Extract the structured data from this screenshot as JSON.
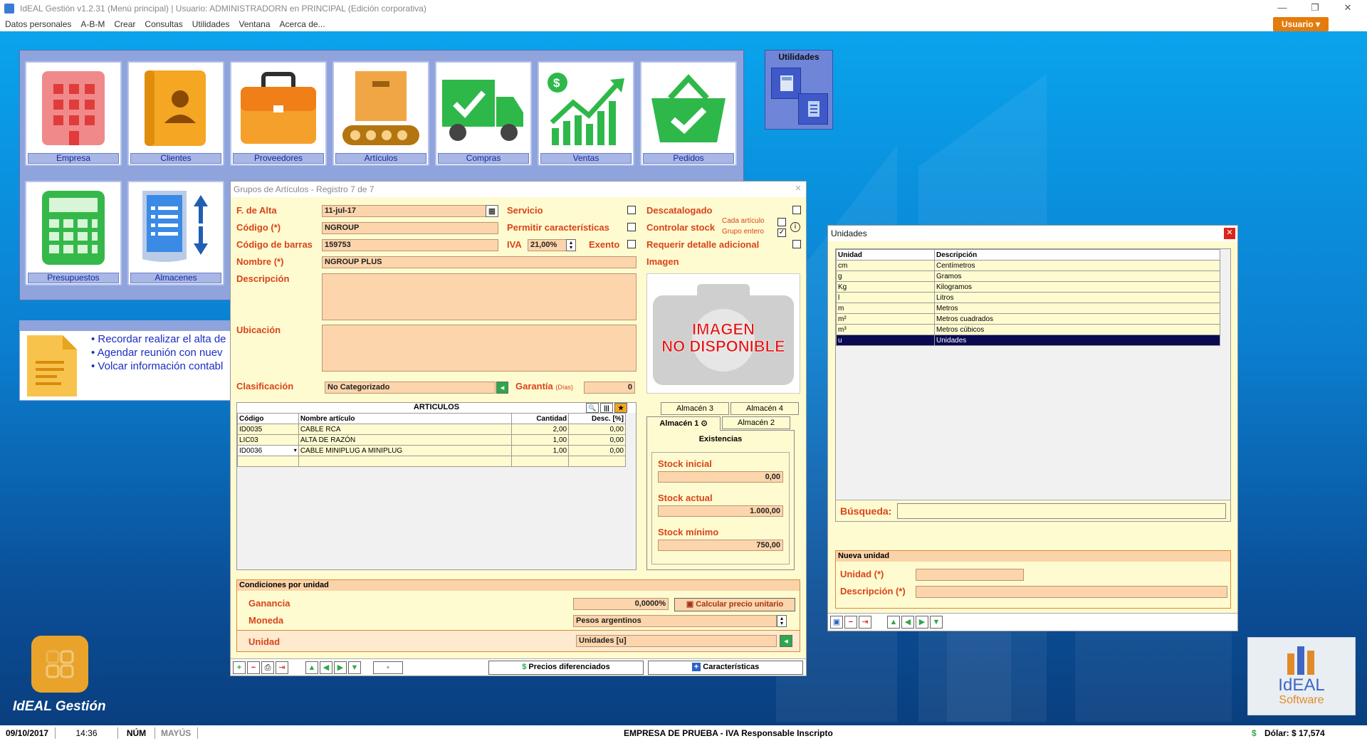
{
  "window": {
    "title": "IdEAL Gestión v1.2.31 (Menú principal) | Usuario: ADMINISTRADORN en PRINCIPAL (Edición corporativa)"
  },
  "menu": [
    "Datos personales",
    "A-B-M",
    "Crear",
    "Consultas",
    "Utilidades",
    "Ventana",
    "Acerca de..."
  ],
  "user_button": "Usuario ▾",
  "tiles_row1": [
    "Empresa",
    "Clientes",
    "Proveedores",
    "Artículos",
    "Compras",
    "Ventas",
    "Pedidos"
  ],
  "tiles_row2": [
    "Presupuestos",
    "Almacenes"
  ],
  "utilities": {
    "title": "Utilidades"
  },
  "reminders": [
    "• Recordar realizar el alta de",
    "• Agendar reunión con nuev",
    "• Volcar información contabl"
  ],
  "brand": {
    "name": "IdEAL Gestión",
    "logo_text1": "IdEAL",
    "logo_text2": "Software"
  },
  "grupos": {
    "title": "Grupos de Artículos - Registro 7 de 7",
    "labels": {
      "alta": "F. de Alta",
      "codigo": "Código (*)",
      "barras": "Código de barras",
      "nombre": "Nombre (*)",
      "descripcion": "Descripción",
      "ubicacion": "Ubicación",
      "clasificacion": "Clasificación",
      "garantia": "Garantía",
      "dias": "(Días)",
      "servicio": "Servicio",
      "permitir": "Permitir características",
      "iva": "IVA",
      "exento": "Exento",
      "descatalogado": "Descatalogado",
      "controlar": "Controlar stock",
      "cada": "Cada artículo",
      "grupo_entero": "Grupo entero",
      "requerir": "Requerir detalle adicional",
      "imagen": "Imagen"
    },
    "values": {
      "alta": "11-jul-17",
      "codigo": "NGROUP",
      "barras": "159753",
      "iva": "21,00%",
      "nombre": "NGROUP PLUS",
      "clasificacion": "No Categorizado",
      "garantia": "0"
    },
    "image_text": [
      "IMAGEN",
      "NO DISPONIBLE"
    ],
    "articulos": {
      "header": "ARTICULOS",
      "columns": [
        "Código",
        "Nombre artículo",
        "Cantidad",
        "Desc. [%]"
      ],
      "rows": [
        [
          "ID0035",
          "CABLE RCA",
          "2,00",
          "0,00"
        ],
        [
          "LIC03",
          "ALTA DE RAZÓN",
          "1,00",
          "0,00"
        ],
        [
          "ID0036",
          "CABLE MINIPLUG A MINIPLUG",
          "1,00",
          "0,00"
        ]
      ]
    },
    "almacen": {
      "tabs_back": [
        "Almacén 3",
        "Almacén 4"
      ],
      "tabs_front": [
        "Almacén 1",
        "Almacén 2"
      ],
      "existencias": "Existencias",
      "stock_inicial_label": "Stock inicial",
      "stock_inicial": "0,00",
      "stock_actual_label": "Stock actual",
      "stock_actual": "1.000,00",
      "stock_minimo_label": "Stock mínimo",
      "stock_minimo": "750,00"
    },
    "condiciones": {
      "header": "Condiciones por unidad",
      "ganancia_label": "Ganancia",
      "ganancia": "0,0000%",
      "calcular": "Calcular precio unitario",
      "moneda_label": "Moneda",
      "moneda": "Pesos argentinos",
      "unidad_label": "Unidad",
      "unidad": "Unidades [u]"
    },
    "footer": {
      "precios": "Precios diferenciados",
      "caracteristicas": "Características"
    }
  },
  "unidades": {
    "title": "Unidades",
    "columns": [
      "Unidad",
      "Descripción"
    ],
    "rows": [
      [
        "cm",
        "Centímetros"
      ],
      [
        "g",
        "Gramos"
      ],
      [
        "Kg",
        "Kilogramos"
      ],
      [
        "l",
        "Litros"
      ],
      [
        "m",
        "Metros"
      ],
      [
        "m²",
        "Metros cuadrados"
      ],
      [
        "m³",
        "Metros cúbicos"
      ],
      [
        "u",
        "Unidades"
      ]
    ],
    "selected_index": 7,
    "busqueda": "Búsqueda:",
    "nueva": "Nueva unidad",
    "unidad_label": "Unidad (*)",
    "descripcion_label": "Descripción (*)"
  },
  "status": {
    "date": "09/10/2017",
    "time": "14:36",
    "num": "NÚM",
    "mayus": "MAYÚS",
    "company": "EMPRESA DE PRUEBA - IVA Responsable Inscripto",
    "dolar": "Dólar: $ 17,574"
  },
  "colors": {
    "label": "#d9431b",
    "field": "#fcd5ac",
    "form_bg": "#fffbd0",
    "accent": "#e47b0c",
    "tile_panel": "#8fa3dd"
  }
}
